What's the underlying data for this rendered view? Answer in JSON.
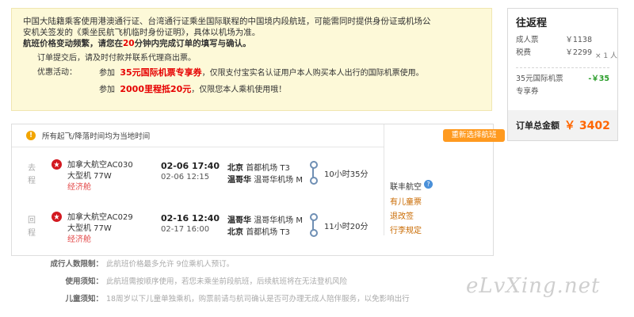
{
  "notice": {
    "line1": "中国大陆籍乘客使用港澳通行证、台湾通行证乘坐国际联程的中国境内段航班，可能需同时提供身份证或机场公",
    "line2": "安机关签发的《乘坐民航飞机临时身份证明》，具体以机场为准。",
    "line3_a": "航班价格变动频繁，请您在",
    "line3_red": "20",
    "line3_b": "分钟内完成订单的填写与确认。",
    "sub": "订单提交后，请及时付款并联系代理商出票。",
    "promo_label": "优惠活动：",
    "promo1_a": "参加",
    "promo1_big": "35元国际机票专享券",
    "promo1_b": "，仅限支付宝实名认证用户本人购买本人出行的国际机票使用。",
    "promo2_a": "参加",
    "promo2_big": "2000里程抵20元",
    "promo2_b": "，仅限您本人乘机使用哦！"
  },
  "price": {
    "title": "往返程",
    "adult_label": "成人票",
    "adult_value": "￥1138",
    "tax_label": "税费",
    "tax_value": "￥2299",
    "qty": "× 1 人",
    "promo_label": "35元国际机票",
    "promo_value": "-￥35",
    "promo_sub": "专享券",
    "total_label": "订单总金额",
    "total_value": "￥ 3402"
  },
  "flights": {
    "tz_note": "所有起飞/降落时间均为当地时间",
    "rebook": "重新选择航班",
    "legs": [
      {
        "dir": "去程",
        "airline": "加拿大航空AC030",
        "plane": "大型机 77W",
        "cabin": "经济舱",
        "dep": "02-06 17:40",
        "arr": "02-06 12:15",
        "dep_city": "北京",
        "dep_airport": "首都机场 T3",
        "arr_city": "温哥华",
        "arr_airport": "温哥华机场 M",
        "dur": "10小时35分"
      },
      {
        "dir": "回程",
        "airline": "加拿大航空AC029",
        "plane": "大型机 77W",
        "cabin": "经济舱",
        "dep": "02-16 12:40",
        "arr": "02-17 16:00",
        "dep_city": "温哥华",
        "dep_airport": "温哥华机场 M",
        "arr_city": "北京",
        "arr_airport": "首都机场 T3",
        "dur": "11小时20分"
      }
    ],
    "side": {
      "carrier": "联丰航空",
      "links": [
        "有儿童票",
        "退改签",
        "行李规定"
      ]
    }
  },
  "rules": [
    {
      "k": "成行人数限制：",
      "v": "此航班价格最多允许 9位乘机人预订。"
    },
    {
      "k": "使用须知：",
      "v": "此航班需按顺序使用，若您未乘坐前段航班，后续航班将在无法登机风险"
    },
    {
      "k": "儿童须知：",
      "v": "18周岁以下儿童单独乘机，购票前请与航司确认是否可办理无成人陪伴服务，以免影响出行"
    }
  ],
  "watermark": "eLvXing.net",
  "colors": {
    "notice_bg": "#fdf9d8",
    "accent_orange": "#ff6600",
    "rebook_bg": "#ff9a1f",
    "promo_green": "#2a9d2a",
    "alert_red": "#e60000"
  }
}
